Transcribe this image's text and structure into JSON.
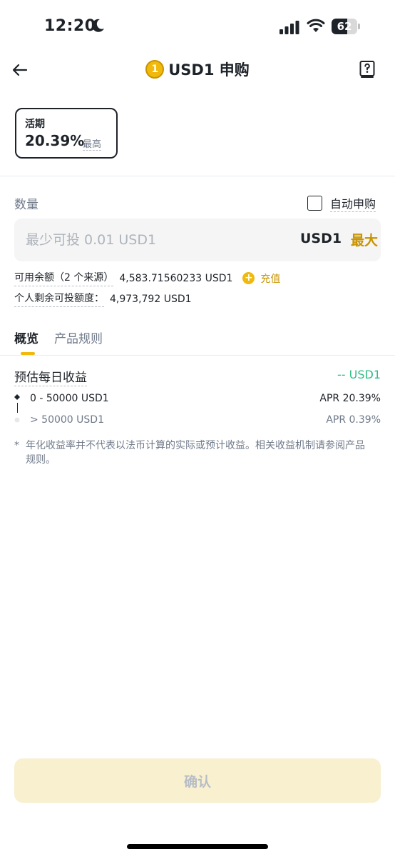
{
  "status_bar": {
    "time": "12:20",
    "battery_level": "62",
    "battery_fraction": 0.62
  },
  "header": {
    "coin_symbol": "1",
    "title": "USD1 申购"
  },
  "product": {
    "term": "活期",
    "rate": "20.39%",
    "rate_tag": "最高"
  },
  "amount": {
    "label": "数量",
    "auto_subscribe_label": "自动申购",
    "auto_subscribe_checked": false,
    "placeholder": "最少可投 0.01 USD1",
    "value": "",
    "unit": "USD1",
    "max_label": "最大"
  },
  "balances": {
    "available_label": "可用余额（2 个来源）",
    "available_value": "4,583.71560233 USD1",
    "deposit_label": "充值",
    "remaining_label": "个人剩余可投额度：",
    "remaining_value": "4,973,792 USD1"
  },
  "tabs": [
    {
      "label": "概览",
      "active": true
    },
    {
      "label": "产品规则",
      "active": false
    }
  ],
  "earnings": {
    "label": "预估每日收益",
    "value": "-- USD1",
    "tiers": [
      {
        "range": "0 - 50000 USD1",
        "apr": "APR 20.39%",
        "active": true
      },
      {
        "range": "> 50000 USD1",
        "apr": "APR 0.39%",
        "active": false
      }
    ]
  },
  "disclaimer": {
    "marker": "*",
    "text": "年化收益率并不代表以法币计算的实际或预计收益。相关收益机制请参阅产品规则。"
  },
  "confirm_label": "确认",
  "colors": {
    "accent": "#f0b90b",
    "accent_text": "#c99400",
    "positive": "#2ebd85",
    "text_secondary": "#707a8a",
    "button_disabled_bg": "#f8f0cf"
  }
}
